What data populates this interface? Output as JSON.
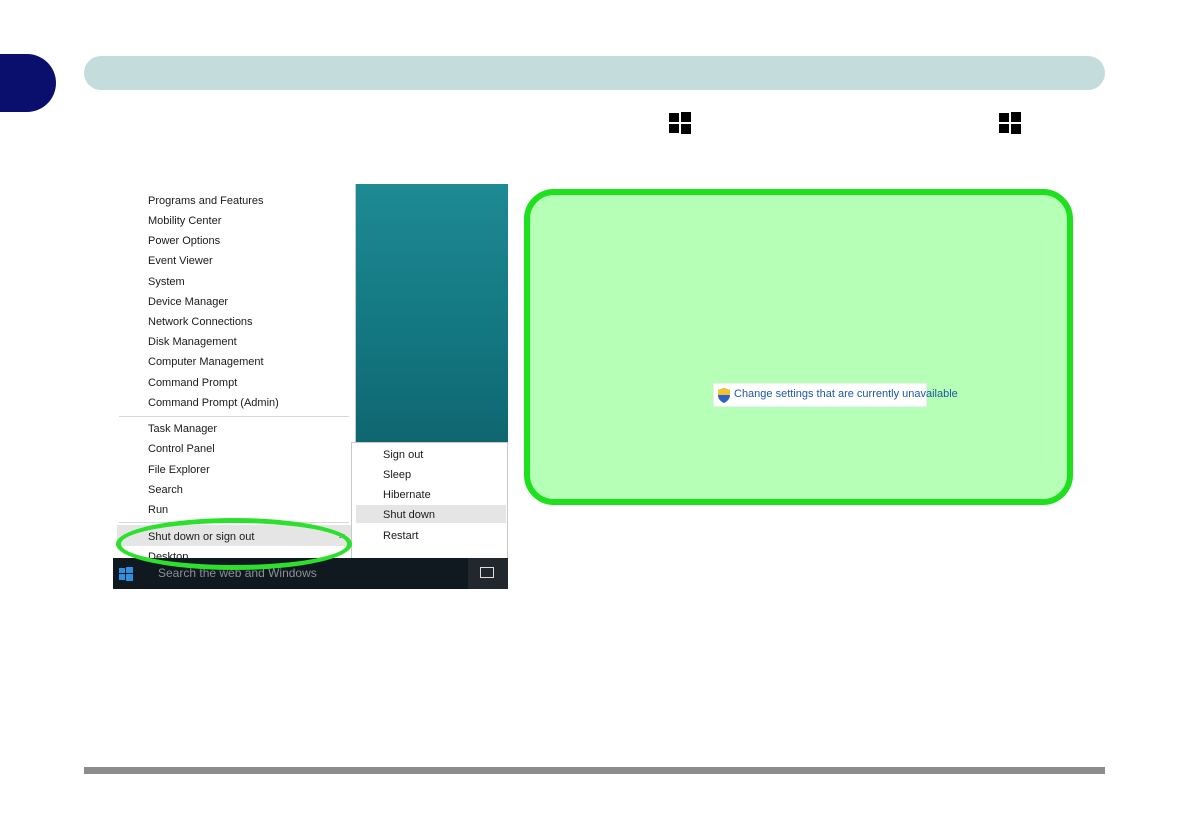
{
  "header": {
    "chapter_tab": "",
    "bar_text": ""
  },
  "win_key_icons": [
    "windows-logo",
    "windows-logo"
  ],
  "winx_menu": {
    "group1": [
      "Programs and Features",
      "Mobility Center",
      "Power Options",
      "Event Viewer",
      "System",
      "Device Manager",
      "Network Connections",
      "Disk Management",
      "Computer Management",
      "Command Prompt",
      "Command Prompt (Admin)"
    ],
    "group2": [
      "Task Manager",
      "Control Panel",
      "File Explorer",
      "Search",
      "Run"
    ],
    "shutdown_label": "Shut down or sign out",
    "chevron": ">",
    "desktop_label": "Desktop"
  },
  "submenu": {
    "items": [
      "Sign out",
      "Sleep",
      "Hibernate",
      "Shut down",
      "Restart"
    ],
    "highlighted": "Shut down"
  },
  "taskbar": {
    "search_placeholder": "Search the web and Windows"
  },
  "note_box": {
    "uac_link": "Change settings that are currently unavailable"
  },
  "colors": {
    "chapter_tab": "#0a0f6e",
    "header_bar": "#c5dcdc",
    "note_fill": "#b6ffb6",
    "note_border": "#1ee01e",
    "highlight_ellipse": "#2ee02e"
  }
}
